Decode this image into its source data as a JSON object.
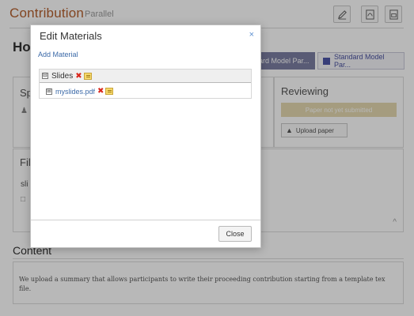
{
  "header": {
    "title": "Contribution",
    "subtitle": "Parallel",
    "buttons": [
      "edit-icon",
      "pdf-icon",
      "export-icon"
    ]
  },
  "main": {
    "heading_partial": "Ho",
    "tags": [
      {
        "label": "dard Model Par...",
        "style": "dark",
        "color": "#7c7fa3"
      },
      {
        "label": "Standard Model Par...",
        "style": "light",
        "color": "#4d55a8"
      }
    ],
    "speakers_partial": "Sp",
    "speaker_icon": "user-icon",
    "reviewing": {
      "title": "Reviewing",
      "status": "Paper not yet submitted",
      "status_color": "#e5d9b0",
      "upload_label": "Upload paper"
    },
    "files_partial": "Fil",
    "file_partial": "sli",
    "file_icon": "document-icon"
  },
  "content": {
    "title": "Content",
    "text": "We upload a summary that allows participants to write their proceeding contribution starting from a template tex file."
  },
  "dialog": {
    "title": "Edit Materials",
    "close_symbol": "×",
    "add_material": "Add Material",
    "tree": {
      "folder": {
        "toggle": "⊟",
        "label": "Slides"
      },
      "file": {
        "toggle": "⊞",
        "label": "myslides.pdf"
      }
    },
    "close_button": "Close"
  },
  "colors": {
    "accent": "#b4602f",
    "link": "#3c6aa8",
    "delete": "#d9261c"
  }
}
